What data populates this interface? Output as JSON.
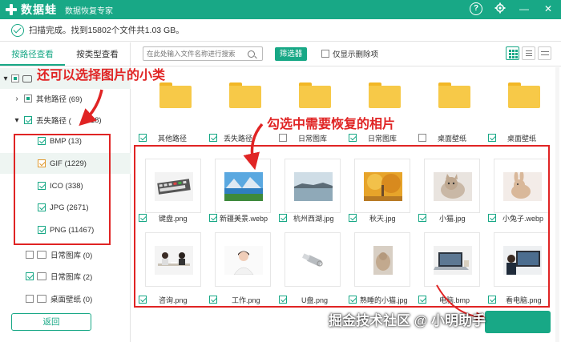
{
  "titlebar": {
    "app_name": "数据蛙",
    "subtitle": "数据恢复专家",
    "help_icon": "?",
    "settings_icon": "gear-icon",
    "minimize_icon": "—",
    "close_icon": "✕"
  },
  "status": {
    "text": "扫描完成。找到15802个文件共1.03 GB。"
  },
  "left_tabs": [
    {
      "label": "按路径查看",
      "active": true
    },
    {
      "label": "按类型查看",
      "active": false
    }
  ],
  "tree": {
    "other_path": "其他路径 (69)",
    "lost_path": "丢失路径 (",
    "lost_path_count": "18)",
    "types": [
      {
        "label": "BMP (13)",
        "checked": true
      },
      {
        "label": "GIF (1229)",
        "checked": true
      },
      {
        "label": "ICO (338)",
        "checked": true
      },
      {
        "label": "JPG (2671)",
        "checked": true
      },
      {
        "label": "PNG (11467)",
        "checked": true
      }
    ],
    "daily1": "日常图库 (0)",
    "daily2": "日常图库 (2)",
    "desktop": "桌面壁纸 (0)"
  },
  "back_button": "返回",
  "toolbar": {
    "search_placeholder": "在此处输入文件名称进行搜索",
    "filter_label": "筛选器",
    "deleted_only_label": "仅显示删除项"
  },
  "folders": [
    {
      "label": "其他路径",
      "checked": true
    },
    {
      "label": "丢失路径",
      "checked": true
    },
    {
      "label": "日常图库",
      "checked": false
    },
    {
      "label": "日常图库",
      "checked": true
    },
    {
      "label": "桌面壁纸",
      "checked": false
    },
    {
      "label": "桌面壁纸",
      "checked": true
    }
  ],
  "files_row1": [
    {
      "label": "键盘.png",
      "thumb": "keyboard"
    },
    {
      "label": "新疆美景.webp",
      "thumb": "landscape"
    },
    {
      "label": "杭州西湖.jpg",
      "thumb": "lake"
    },
    {
      "label": "秋天.jpg",
      "thumb": "autumn"
    },
    {
      "label": "小猫.jpg",
      "thumb": "cat"
    },
    {
      "label": "小兔子.webp",
      "thumb": "rabbit"
    }
  ],
  "files_row2": [
    {
      "label": "咨询.png",
      "thumb": "office"
    },
    {
      "label": "工作.png",
      "thumb": "woman"
    },
    {
      "label": "U盘.png",
      "thumb": "usb"
    },
    {
      "label": "熟睡的小猫.jpg",
      "thumb": "sleepcat"
    },
    {
      "label": "电脑.bmp",
      "thumb": "laptop"
    },
    {
      "label": "看电脑.png",
      "thumb": "watching"
    }
  ],
  "annotations": {
    "left": "还可以选择图片的小类",
    "top": "勾选中需要恢复的相片"
  },
  "watermark": "掘金技术社区 @ 小明助手",
  "colors": {
    "accent": "#18a886",
    "annotation": "#e02424",
    "folder": "#f7c948"
  }
}
